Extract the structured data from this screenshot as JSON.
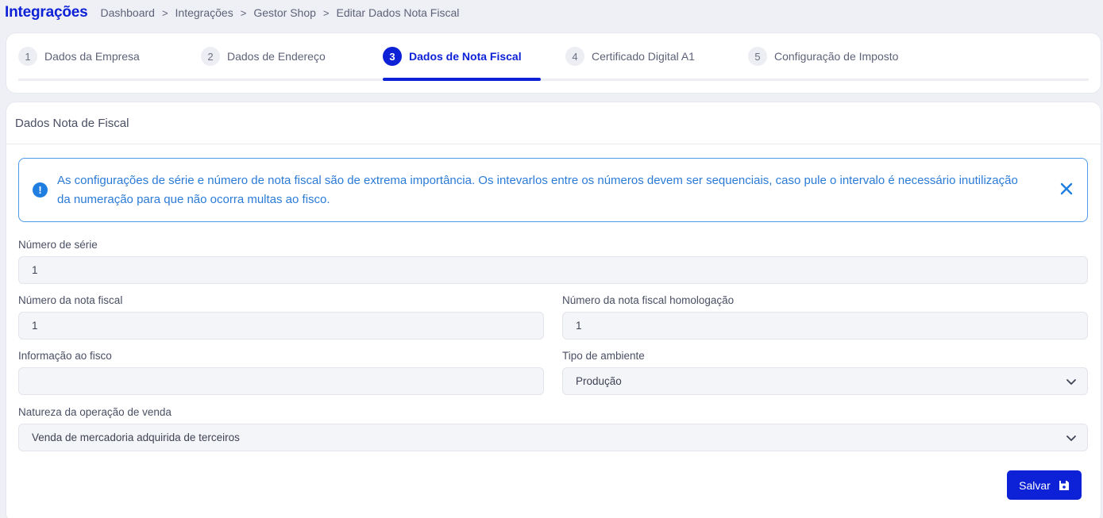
{
  "header": {
    "title": "Integrações",
    "breadcrumb": [
      "Dashboard",
      "Integrações",
      "Gestor Shop",
      "Editar Dados Nota Fiscal"
    ],
    "separator": ">"
  },
  "stepper": {
    "steps": [
      {
        "number": "1",
        "label": "Dados da Empresa"
      },
      {
        "number": "2",
        "label": "Dados de Endereço"
      },
      {
        "number": "3",
        "label": "Dados de Nota Fiscal"
      },
      {
        "number": "4",
        "label": "Certificado Digital A1"
      },
      {
        "number": "5",
        "label": "Configuração de Imposto"
      }
    ],
    "active_step": 3
  },
  "card": {
    "title": "Dados Nota de Fiscal"
  },
  "alert": {
    "icon": "info-icon",
    "text": "As configurações de série e número de nota fiscal são de extrema importância. Os intevarlos entre os números devem ser sequenciais, caso pule o intervalo é necessário inutilização da numeração para que não ocorra multas ao fisco.",
    "close_icon": "close-icon"
  },
  "form": {
    "serie": {
      "label": "Número de série",
      "value": "1"
    },
    "nota_fiscal": {
      "label": "Número da nota fiscal",
      "value": "1"
    },
    "nota_fiscal_homologacao": {
      "label": "Número da nota fiscal homologação",
      "value": "1"
    },
    "informacao_fisco": {
      "label": "Informação ao fisco",
      "value": ""
    },
    "tipo_ambiente": {
      "label": "Tipo de ambiente",
      "value": "Produção"
    },
    "natureza_operacao": {
      "label": "Natureza da operação de venda",
      "value": "Venda de mercadoria adquirida de terceiros"
    }
  },
  "actions": {
    "save_label": "Salvar",
    "save_icon": "floppy-disk-icon"
  },
  "colors": {
    "primary": "#0d21d6",
    "info": "#2b7bd6",
    "background": "#eef0f5"
  }
}
